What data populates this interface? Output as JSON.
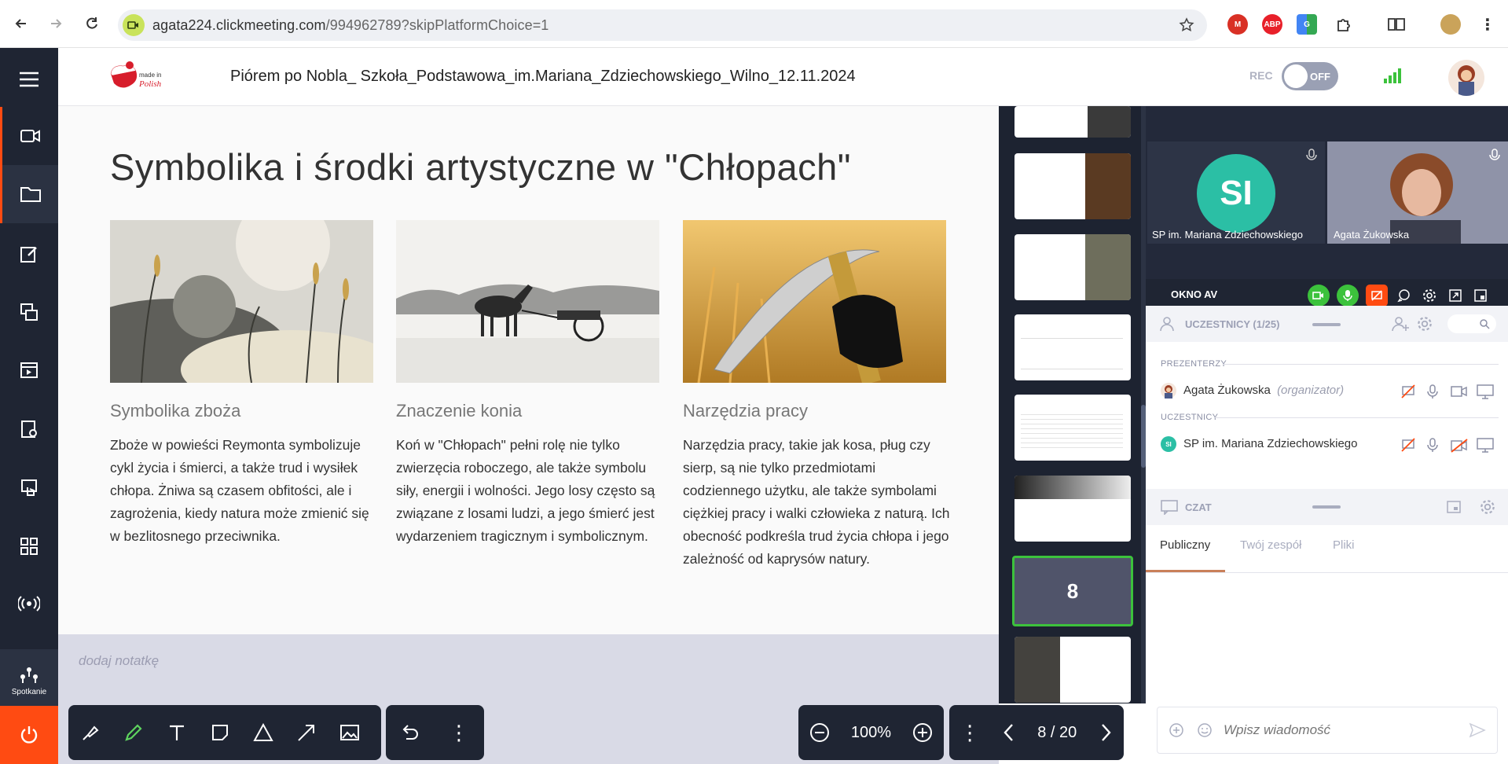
{
  "browser": {
    "url_host": "agata224.clickmeeting.com",
    "url_path": "/994962789?skipPlatformChoice=1",
    "extensions": [
      "gmail-icon",
      "adblock-icon",
      "translate-icon",
      "puzzle-icon"
    ]
  },
  "app": {
    "title": "Piórem po Nobla_ Szkoła_Podstawowa_im.Mariana_Zdziechowskiego_Wilno_12.11.2024",
    "logo_text": "made in Polish",
    "rec_label": "REC",
    "rec_toggle": "OFF",
    "sidebar_bottom_label": "Spotkanie"
  },
  "slide": {
    "title": "Symbolika i środki artystyczne w \"Chłopach\"",
    "cards": [
      {
        "heading": "Symbolika zboża",
        "text": "Zboże w powieści Reymonta symbolizuje cykl życia i śmierci, a także trud i wysiłek chłopa. Żniwa są czasem obfitości, ale i zagrożenia, kiedy natura może zmienić się w bezlitosnego przeciwnika."
      },
      {
        "heading": "Znaczenie konia",
        "text": "Koń w \"Chłopach\" pełni rolę nie tylko zwierzęcia roboczego, ale także symbolu siły, energii i wolności. Jego losy często są związane z losami ludzi, a jego śmierć jest wydarzeniem tragicznym i symbolicznym."
      },
      {
        "heading": "Narzędzia pracy",
        "text": "Narzędzia pracy, takie jak kosa, pług czy sierp, są nie tylko przedmiotami codziennego użytku, ale także symbolami ciężkiej pracy i walki człowieka z naturą. Ich obecność podkreśla trud życia chłopa i jego zależność od kaprysów natury."
      }
    ],
    "notes_placeholder": "dodaj notatkę"
  },
  "toolbar": {
    "zoom": "100%",
    "page": "8 / 20",
    "current_thumb": "8"
  },
  "video": {
    "tile1_initials": "SI",
    "tile1_name": "SP im. Mariana Zdziechowskiego",
    "tile2_name": "Agata Żukowska",
    "av_window_label": "OKNO AV"
  },
  "participants": {
    "header": "UCZESTNICY (1/25)",
    "presenters_label": "PREZENTERZY",
    "presenter_name": "Agata Żukowska",
    "presenter_role": "(organizator)",
    "attendees_label": "UCZESTNICY",
    "attendee_initials": "SI",
    "attendee_name": "SP im. Mariana Zdziechowskiego"
  },
  "chat": {
    "header": "CZAT",
    "tabs": [
      "Publiczny",
      "Twój zespół",
      "Pliki"
    ],
    "input_placeholder": "Wpisz wiadomość"
  },
  "colors": {
    "sidebar": "#1f2533",
    "accent_green": "#3cc23c",
    "power_red": "#ff4b12",
    "teal": "#2bbfa5",
    "tab_active": "#c9805a"
  }
}
